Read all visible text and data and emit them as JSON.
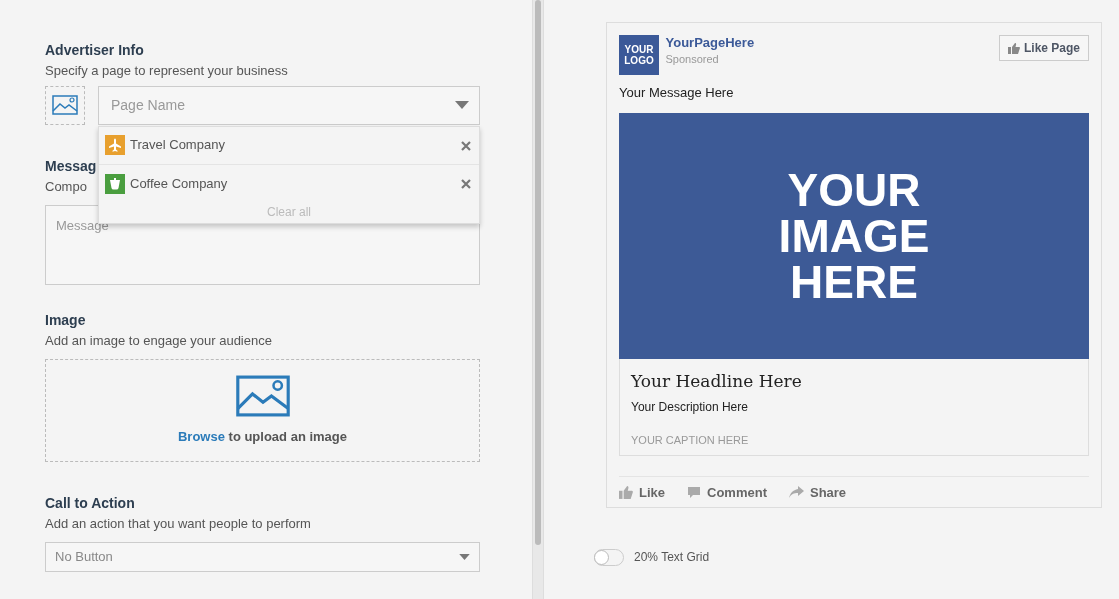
{
  "advertiser": {
    "title": "Advertiser Info",
    "subtitle": "Specify a page to represent your business",
    "field": {
      "placeholder": "Page Name"
    },
    "options": [
      {
        "label": "Travel Company",
        "color": "#e8a02e",
        "kind": "plane"
      },
      {
        "label": "Coffee Company",
        "color": "#4a9e3f",
        "kind": "cup"
      }
    ],
    "clear": "Clear all"
  },
  "message": {
    "title": "Messag",
    "subtitle": "Compo",
    "field": {
      "placeholder": "Message"
    }
  },
  "image": {
    "title": "Image",
    "subtitle": "Add an image to engage your audience",
    "link": "Browse",
    "upload_text": "to upload an image"
  },
  "call_to_action": {
    "title": "Call to Action",
    "subtitle": "Add an action that you want people to perform",
    "select": {
      "value": "No Button"
    }
  },
  "preview": {
    "logo": [
      "YOUR",
      "LOGO"
    ],
    "page_name": "YourPageHere",
    "sponsored": "Sponsored",
    "like_button": "Like Page",
    "message": "Your Message Here",
    "image_text": [
      "YOUR",
      "IMAGE",
      "HERE"
    ],
    "headline": "Your Headline Here",
    "description": "Your Description Here",
    "caption": "YOUR CAPTION HERE",
    "actions": [
      {
        "label": "Like",
        "kind": "like"
      },
      {
        "label": "Comment",
        "kind": "comment"
      },
      {
        "label": "Share",
        "kind": "share"
      }
    ]
  },
  "text_grid": {
    "label": "20% Text Grid",
    "on": false
  }
}
